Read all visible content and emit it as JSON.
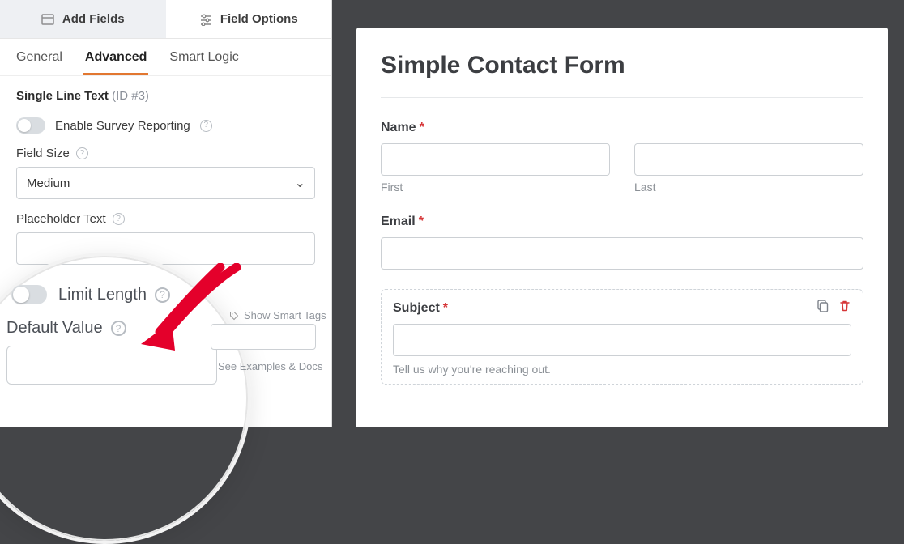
{
  "topTabs": {
    "add": "Add Fields",
    "options": "Field Options"
  },
  "subTabs": {
    "general": "General",
    "advanced": "Advanced",
    "smart": "Smart Logic"
  },
  "field": {
    "name": "Single Line Text",
    "id": "(ID #3)"
  },
  "survey": {
    "label": "Enable Survey Reporting"
  },
  "size": {
    "label": "Field Size",
    "value": "Medium"
  },
  "placeholder": {
    "label": "Placeholder Text",
    "value": ""
  },
  "limit": {
    "label": "Limit Length"
  },
  "smartTags": "Show Smart Tags",
  "default": {
    "label": "Default Value",
    "value": ""
  },
  "examples": "See Examples & Docs",
  "form": {
    "title": "Simple Contact Form",
    "name": {
      "label": "Name",
      "first": "First",
      "last": "Last"
    },
    "email": {
      "label": "Email"
    },
    "subject": {
      "label": "Subject",
      "helper": "Tell us why you're reaching out."
    }
  }
}
